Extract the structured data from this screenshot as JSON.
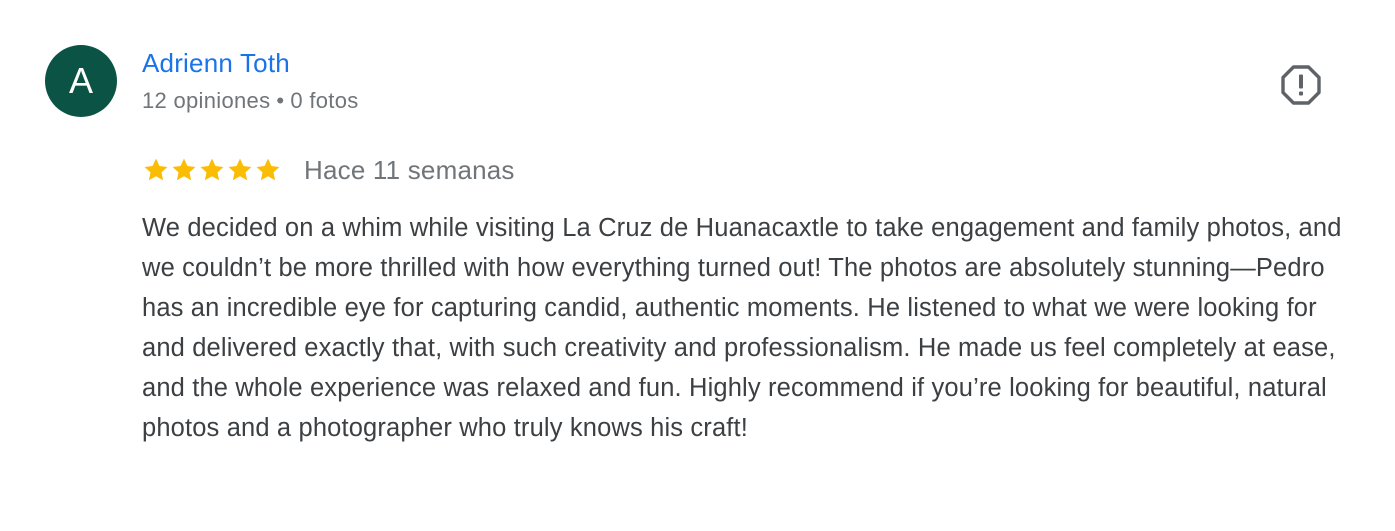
{
  "reviewer": {
    "initial": "A",
    "name": "Adrienn Toth",
    "reviews_count": "12 opiniones",
    "separator": "•",
    "photos_count": "0 fotos",
    "avatar_color": "#0b5345"
  },
  "review": {
    "rating": 5,
    "max_rating": 5,
    "star_color": "#fbbc04",
    "date": "Hace 11 semanas",
    "text": "We decided on a whim while visiting La Cruz de Huanacaxtle to take engagement and family photos, and we couldn’t be more thrilled with how everything turned out! The photos are absolutely stunning—Pedro has an incredible eye for capturing candid, authentic moments. He listened to what we were looking for and delivered exactly that, with such creativity and professionalism. He made us feel completely at ease, and the whole experience was relaxed and fun. Highly recommend if you’re looking for beautiful, natural photos and a photographer who truly knows his craft!"
  },
  "actions": {
    "report_icon": "report-icon"
  },
  "colors": {
    "name_link": "#1a73e8",
    "meta_text": "#70757a",
    "body_text": "#3c4043",
    "icon": "#5f6368"
  }
}
